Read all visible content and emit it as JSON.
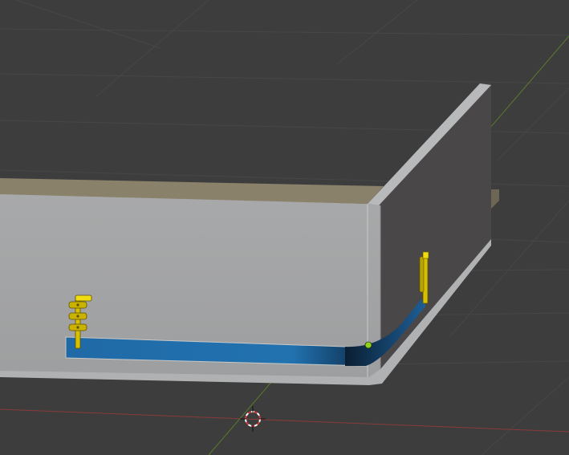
{
  "app": {
    "editor": "3D Viewport",
    "view": "perspective"
  },
  "viewport": {
    "background_color": "#3d3d3d",
    "grid_line_color": "#474747",
    "x_axis_color": "#8a3b3b",
    "y_axis_color": "#5a7a2e",
    "overlays_visible": true
  },
  "scene": {
    "objects": [
      {
        "name": "box-front-panel",
        "type": "mesh",
        "color": "#a2a3a4"
      },
      {
        "name": "box-right-panel",
        "type": "mesh",
        "color": "#4a4749"
      },
      {
        "name": "box-top-edge",
        "type": "mesh",
        "color": "#8a816b"
      },
      {
        "name": "drawer-slot",
        "type": "mesh",
        "color": "#1f6aa6",
        "selected": true
      },
      {
        "name": "barrel-bolt-left",
        "type": "mesh",
        "color": "#e0c800"
      },
      {
        "name": "barrel-bolt-right",
        "type": "mesh",
        "color": "#e0c800"
      }
    ],
    "active_vertex_color": "#8fd11c",
    "cursor_3d": {
      "ring_colors": [
        "#d23b3b",
        "#ffffff"
      ]
    }
  }
}
